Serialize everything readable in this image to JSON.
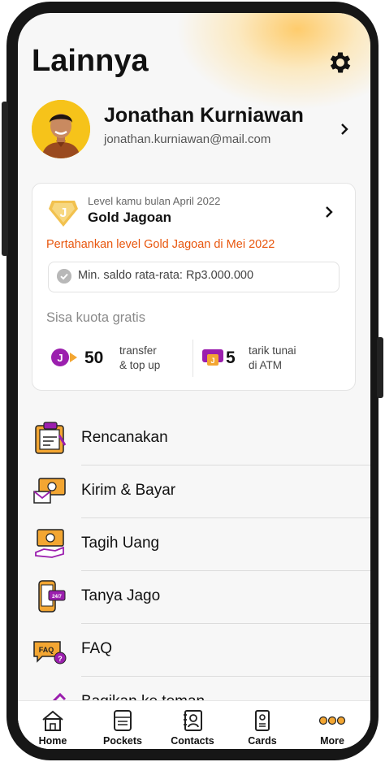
{
  "header": {
    "title": "Lainnya"
  },
  "profile": {
    "name": "Jonathan Kurniawan",
    "email": "jonathan.kurniawan@mail.com"
  },
  "level": {
    "label": "Level kamu bulan April 2022",
    "name": "Gold Jagoan",
    "badge_letter": "J",
    "keep_text": "Pertahankan level Gold Jagoan di Mei 2022",
    "min_balance": "Min. saldo rata-rata: Rp3.000.000"
  },
  "quota": {
    "title": "Sisa kuota gratis",
    "transfer": {
      "value": "50",
      "line1": "transfer",
      "line2": "& top up"
    },
    "atm": {
      "value": "5",
      "line1": "tarik tunai",
      "line2": "di ATM"
    }
  },
  "menu": [
    {
      "label": "Rencanakan",
      "icon": "planner-icon"
    },
    {
      "label": "Kirim & Bayar",
      "icon": "send-money-icon"
    },
    {
      "label": "Tagih Uang",
      "icon": "request-money-icon"
    },
    {
      "label": "Tanya Jago",
      "icon": "chat-support-icon"
    },
    {
      "label": "FAQ",
      "icon": "faq-icon"
    },
    {
      "label": "Bagikan ke teman",
      "icon": "share-icon"
    }
  ],
  "tabs": [
    {
      "label": "Home",
      "icon": "home-icon"
    },
    {
      "label": "Pockets",
      "icon": "pockets-icon"
    },
    {
      "label": "Contacts",
      "icon": "contacts-icon"
    },
    {
      "label": "Cards",
      "icon": "cards-icon"
    },
    {
      "label": "More",
      "icon": "more-icon"
    }
  ],
  "colors": {
    "accent_orange": "#e8560d",
    "brand_yellow": "#f6c31a",
    "purple": "#9b1fae",
    "icon_orange": "#f3a632"
  }
}
